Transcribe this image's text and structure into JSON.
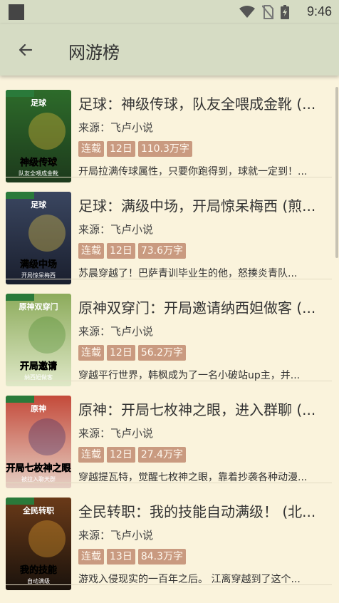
{
  "status_bar": {
    "time": "9:46",
    "icons": [
      "wifi-icon",
      "no-sim-icon",
      "battery-charging-icon"
    ]
  },
  "header": {
    "title": "网游榜",
    "back_icon": "arrow-left-icon"
  },
  "colors": {
    "app_bar": "#d6dcc4",
    "background": "#faf3dc",
    "tag": "#c99a80"
  },
  "books": [
    {
      "title": "足球：神级传球，队友全喂成金靴 (...",
      "source": "来源：飞卢小说",
      "tags": [
        "连载",
        "12日",
        "110.3万字"
      ],
      "desc": "开局拉满传球属性，只要你跑得到，球就一定到！..."
    },
    {
      "title": "足球：满级中场，开局惊呆梅西 (煎...",
      "source": "来源：飞卢小说",
      "tags": [
        "连载",
        "12日",
        "73.6万字"
      ],
      "desc": "苏晨穿越了！巴萨青训毕业生的他，怒揍炎青队..."
    },
    {
      "title": "原神双穿门：开局邀请纳西妲做客 (...",
      "source": "来源：飞卢小说",
      "tags": [
        "连载",
        "12日",
        "56.2万字"
      ],
      "desc": "穿越平行世界，韩枫成为了一名小破站up主，并..."
    },
    {
      "title": "原神：开局七枚神之眼，进入群聊 (...",
      "source": "来源：飞卢小说",
      "tags": [
        "连载",
        "12日",
        "27.4万字"
      ],
      "desc": "穿越提瓦特，觉醒七枚神之眼，靠着抄袭各种动漫..."
    },
    {
      "title": "全民转职：我的技能自动满级！ (北...",
      "source": "来源：飞卢小说",
      "tags": [
        "连载",
        "13日",
        "84.3万字"
      ],
      "desc": "游戏入侵现实的一百年之后。 江离穿越到了这个..."
    }
  ],
  "covers": [
    {
      "lines": [
        "足球",
        "神级传球",
        "队友全喂成金靴"
      ],
      "colors": [
        "#1d3a1c",
        "#2d6b2a",
        "#f3c43c"
      ]
    },
    {
      "lines": [
        "足球",
        "满级中场",
        "开局惊呆梅西"
      ],
      "colors": [
        "#1a1f2e",
        "#3a4660",
        "#f2d24a"
      ]
    },
    {
      "lines": [
        "原神双穿门",
        "开局邀请",
        "纳西妲做客"
      ],
      "colors": [
        "#dfe8c7",
        "#8cab5b",
        "#4a8a2e"
      ]
    },
    {
      "lines": [
        "原神",
        "开局七枚神之眼",
        "被拉入聊天群"
      ],
      "colors": [
        "#e5cfc3",
        "#c44a3a",
        "#3a2a6a"
      ]
    },
    {
      "lines": [
        "全民转职",
        "我的技能",
        "自动满级"
      ],
      "colors": [
        "#1a120c",
        "#6a3a18",
        "#f0a830"
      ]
    }
  ]
}
